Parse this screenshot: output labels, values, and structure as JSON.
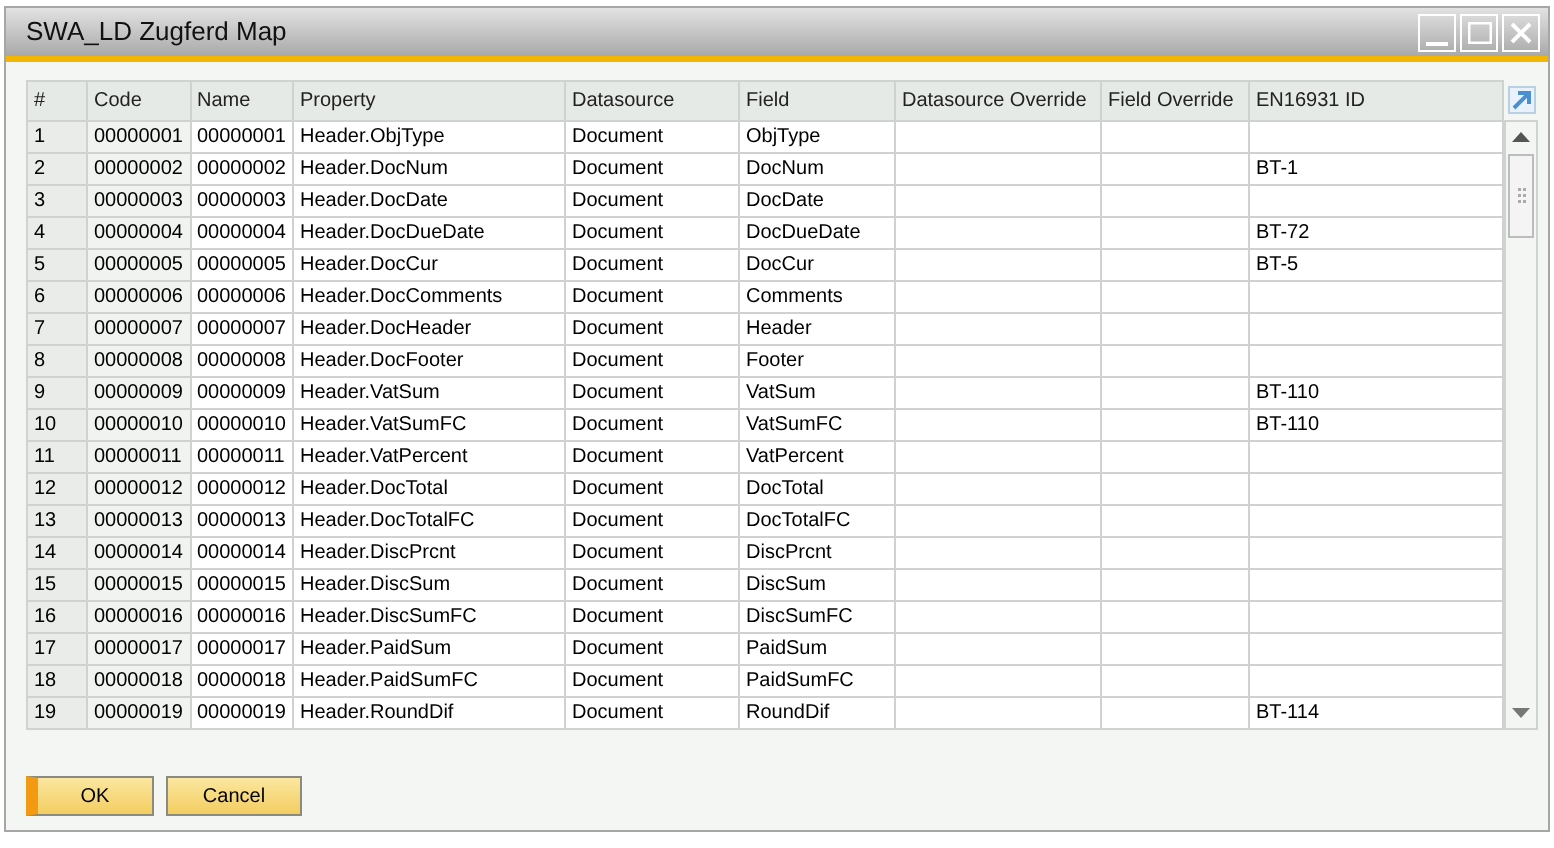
{
  "window": {
    "title": "SWA_LD Zugferd Map"
  },
  "table": {
    "columns": [
      "#",
      "Code",
      "Name",
      "Property",
      "Datasource",
      "Field",
      "Datasource Override",
      "Field Override",
      "EN16931 ID"
    ],
    "rows": [
      {
        "num": "1",
        "code": "00000001",
        "name": "00000001",
        "property": "Header.ObjType",
        "datasource": "Document",
        "field": "ObjType"
      },
      {
        "num": "2",
        "code": "00000002",
        "name": "00000002",
        "property": "Header.DocNum",
        "datasource": "Document",
        "field": "DocNum",
        "en16931_id": "BT-1"
      },
      {
        "num": "3",
        "code": "00000003",
        "name": "00000003",
        "property": "Header.DocDate",
        "datasource": "Document",
        "field": "DocDate"
      },
      {
        "num": "4",
        "code": "00000004",
        "name": "00000004",
        "property": "Header.DocDueDate",
        "datasource": "Document",
        "field": "DocDueDate",
        "en16931_id": "BT-72"
      },
      {
        "num": "5",
        "code": "00000005",
        "name": "00000005",
        "property": "Header.DocCur",
        "datasource": "Document",
        "field": "DocCur",
        "en16931_id": "BT-5"
      },
      {
        "num": "6",
        "code": "00000006",
        "name": "00000006",
        "property": "Header.DocComments",
        "datasource": "Document",
        "field": "Comments"
      },
      {
        "num": "7",
        "code": "00000007",
        "name": "00000007",
        "property": "Header.DocHeader",
        "datasource": "Document",
        "field": "Header"
      },
      {
        "num": "8",
        "code": "00000008",
        "name": "00000008",
        "property": "Header.DocFooter",
        "datasource": "Document",
        "field": "Footer"
      },
      {
        "num": "9",
        "code": "00000009",
        "name": "00000009",
        "property": "Header.VatSum",
        "datasource": "Document",
        "field": "VatSum",
        "en16931_id": "BT-110"
      },
      {
        "num": "10",
        "code": "00000010",
        "name": "00000010",
        "property": "Header.VatSumFC",
        "datasource": "Document",
        "field": "VatSumFC",
        "en16931_id": "BT-110"
      },
      {
        "num": "11",
        "code": "00000011",
        "name": "00000011",
        "property": "Header.VatPercent",
        "datasource": "Document",
        "field": "VatPercent"
      },
      {
        "num": "12",
        "code": "00000012",
        "name": "00000012",
        "property": "Header.DocTotal",
        "datasource": "Document",
        "field": "DocTotal"
      },
      {
        "num": "13",
        "code": "00000013",
        "name": "00000013",
        "property": "Header.DocTotalFC",
        "datasource": "Document",
        "field": "DocTotalFC"
      },
      {
        "num": "14",
        "code": "00000014",
        "name": "00000014",
        "property": "Header.DiscPrcnt",
        "datasource": "Document",
        "field": "DiscPrcnt"
      },
      {
        "num": "15",
        "code": "00000015",
        "name": "00000015",
        "property": "Header.DiscSum",
        "datasource": "Document",
        "field": "DiscSum"
      },
      {
        "num": "16",
        "code": "00000016",
        "name": "00000016",
        "property": "Header.DiscSumFC",
        "datasource": "Document",
        "field": "DiscSumFC"
      },
      {
        "num": "17",
        "code": "00000017",
        "name": "00000017",
        "property": "Header.PaidSum",
        "datasource": "Document",
        "field": "PaidSum"
      },
      {
        "num": "18",
        "code": "00000018",
        "name": "00000018",
        "property": "Header.PaidSumFC",
        "datasource": "Document",
        "field": "PaidSumFC"
      },
      {
        "num": "19",
        "code": "00000019",
        "name": "00000019",
        "property": "Header.RoundDif",
        "datasource": "Document",
        "field": "RoundDif",
        "en16931_id": "BT-114"
      }
    ]
  },
  "buttons": [
    {
      "label": "OK",
      "kind": "primary"
    },
    {
      "label": "Cancel",
      "kind": "secondary"
    }
  ]
}
